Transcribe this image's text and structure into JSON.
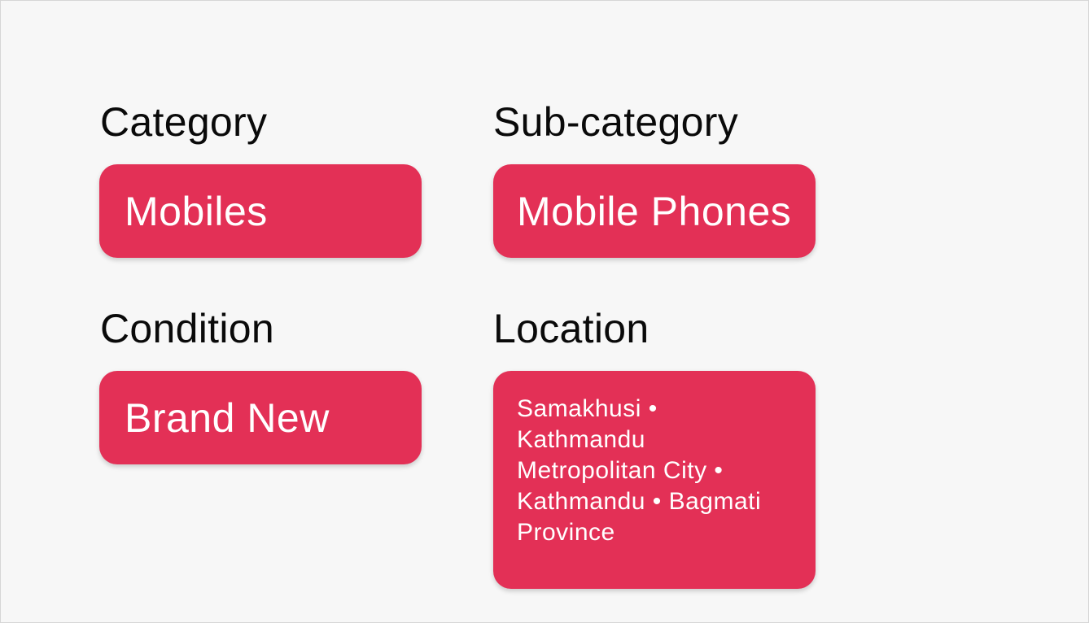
{
  "fields": {
    "category": {
      "label": "Category",
      "value": "Mobiles"
    },
    "subcategory": {
      "label": "Sub-category",
      "value": "Mobile Phones"
    },
    "condition": {
      "label": "Condition",
      "value": "Brand New"
    },
    "location": {
      "label": "Location",
      "value": "Samakhusi • Kathmandu Metropolitan City • Kathmandu • Bagmati Province"
    }
  },
  "colors": {
    "chip_background": "#e33056",
    "chip_text": "#ffffff",
    "label_text": "#0a0a0a",
    "page_background": "#f7f7f7"
  }
}
